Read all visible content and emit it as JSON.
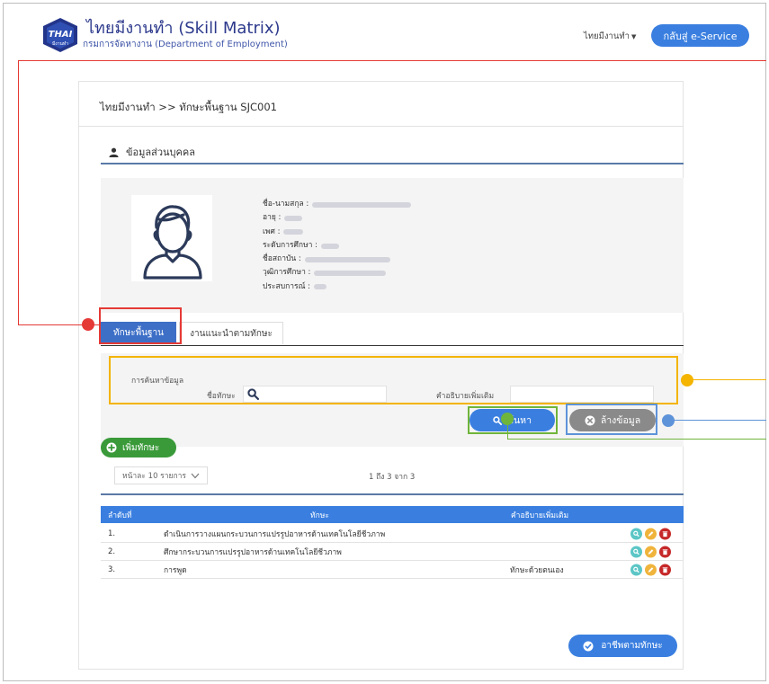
{
  "header": {
    "logo_text": "THAI",
    "logo_subtext": "มีงานทำ",
    "title": "ไทยมีงานทำ (Skill Matrix)",
    "subtitle": "กรมการจัดหางาน (Department of Employment)",
    "user_menu": "ไทยมีงานทำ",
    "eservice_button": "กลับสู่ e-Service"
  },
  "breadcrumb": "ไทยมีงานทำ >> ทักษะพื้นฐาน SJC001",
  "profile": {
    "section_title": "ข้อมูลส่วนบุคคล",
    "fields": [
      {
        "label": "ชื่อ-นามสกุล :"
      },
      {
        "label": "อายุ :"
      },
      {
        "label": "เพศ :"
      },
      {
        "label": "ระดับการศึกษา :"
      },
      {
        "label": "ชื่อสถาบัน :"
      },
      {
        "label": "วุฒิการศึกษา :"
      },
      {
        "label": "ประสบการณ์ :"
      }
    ]
  },
  "tabs": {
    "active": "ทักษะพื้นฐาน",
    "other": "งานแนะนำตามทักษะ"
  },
  "search": {
    "title": "การค้นหาข้อมูล",
    "skill_label": "ชื่อทักษะ",
    "skill_value": "",
    "desc_label": "คำอธิบายเพิ่มเติม",
    "desc_value": "",
    "search_button": "ค้นหา",
    "clear_button": "ล้างข้อมูล"
  },
  "add_skill_button": "เพิ่มทักษะ",
  "pagination": {
    "per_page": "หน้าละ 10 รายการ",
    "range": "1 ถึง 3 จาก 3"
  },
  "table": {
    "columns": [
      "ลำดับที่",
      "ทักษะ",
      "คำอธิบายเพิ่มเติม"
    ],
    "rows": [
      {
        "no": "1.",
        "skill": "ดำเนินการวางแผนกระบวนการแปรรูปอาหารด้านเทคโนโลยีชีวภาพ",
        "desc": ""
      },
      {
        "no": "2.",
        "skill": "ศึกษากระบวนการแปรรูปอาหารด้านเทคโนโลยีชีวภาพ",
        "desc": ""
      },
      {
        "no": "3.",
        "skill": "การพูด",
        "desc": "ทักษะด้วยตนเอง"
      }
    ]
  },
  "approve_button": "อาชีพตามทักษะ",
  "colors": {
    "primary": "#3a7fe0",
    "tab_active": "#3d6fc7",
    "add_green": "#3a9a3a",
    "annotation_red": "#e53935",
    "annotation_orange": "#f4b400",
    "annotation_green": "#6fb53b",
    "annotation_blue": "#5d93d9"
  }
}
